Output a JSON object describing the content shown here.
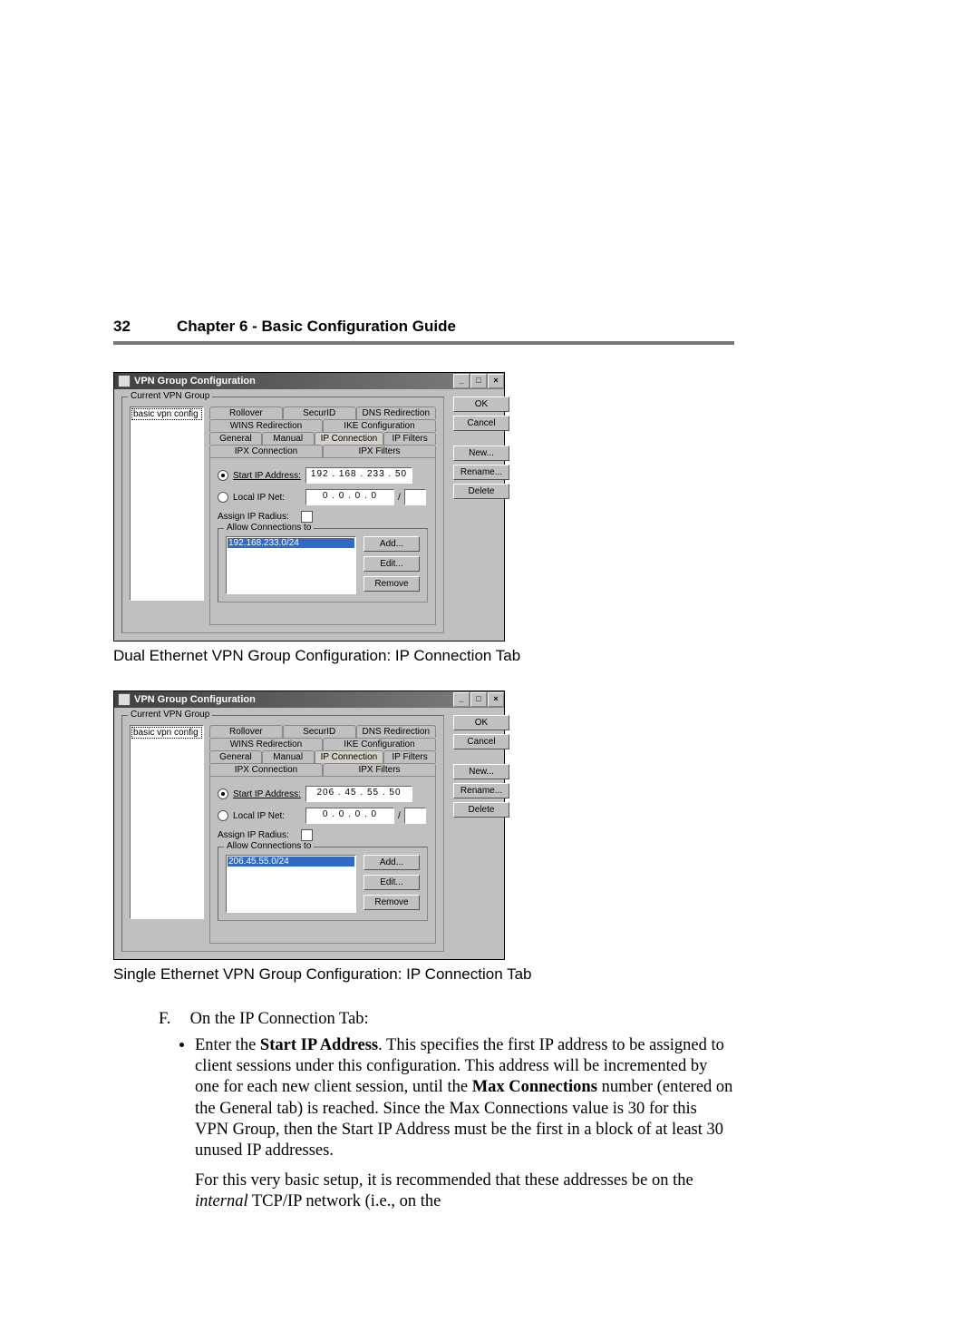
{
  "page": {
    "number": "32",
    "chapter": "Chapter 6 - Basic Configuration Guide"
  },
  "dialog": {
    "title": "VPN Group Configuration",
    "group_label": "Current VPN Group",
    "list_item": "basic vpn config",
    "tabs_row1": [
      "Rollover",
      "SecurID",
      "DNS Redirection"
    ],
    "tabs_row2": [
      "WINS Redirection",
      "IKE Configuration"
    ],
    "tabs_row3": [
      "General",
      "Manual",
      "IP Connection",
      "IP Filters",
      "IPX Connection",
      "IPX Filters"
    ],
    "start_ip_label": "Start IP Address:",
    "local_net_label": "Local IP Net:",
    "assign_radius_label": "Assign IP Radius:",
    "local_net_value": "0 . 0 . 0 . 0",
    "slash": "/",
    "allow_conn_label": "Allow Connections to",
    "btn_add": "Add...",
    "btn_edit": "Edit...",
    "btn_remove": "Remove",
    "side": {
      "ok": "OK",
      "cancel": "Cancel",
      "new": "New...",
      "rename": "Rename...",
      "delete": "Delete"
    },
    "win": {
      "min": "_",
      "max": "□",
      "close": "×"
    }
  },
  "shot1": {
    "start_ip_value": "192 . 168 . 233 . 50",
    "allow_item": "192.168.233.0/24",
    "caption": "Dual Ethernet VPN Group Configuration: IP Connection Tab"
  },
  "shot2": {
    "start_ip_value": "206 . 45 . 55 . 50",
    "allow_item": "206.45.55.0/24",
    "caption": "Single Ethernet VPN Group Configuration: IP Connection Tab"
  },
  "text": {
    "letter": "F.",
    "intro": "On the IP Connection Tab:",
    "bullet_pre": "Enter the ",
    "bullet_bold1": "Start IP Address",
    "bullet_mid1": ". This specifies the first IP address to be assigned to client sessions under this configuration. This address will be incremented by one for each new client session, until the ",
    "bullet_bold2": "Max Connections",
    "bullet_mid2": " number (entered on the General tab) is reached. Since the Max Connections value is 30 for this VPN Group, then the Start IP Address must be the first in a block of at least 30 unused IP addresses.",
    "para2_pre": "For this very basic setup, it is recommended that these addresses be on the ",
    "para2_italic": "internal",
    "para2_post": " TCP/IP network (i.e., on the"
  }
}
